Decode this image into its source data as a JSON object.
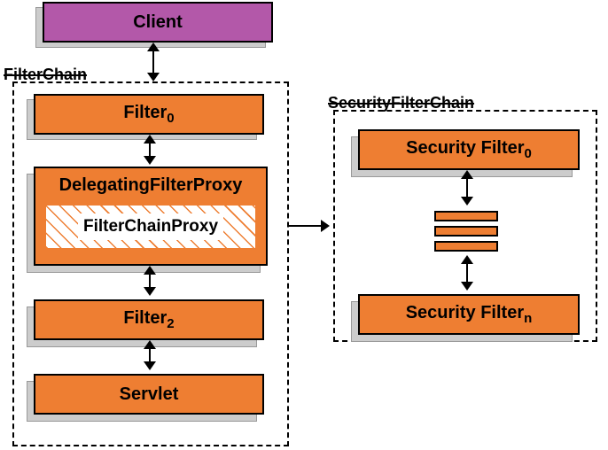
{
  "client": "Client",
  "filterchain_label": "FilterChain",
  "filter0": {
    "name": "Filter",
    "sub": "0"
  },
  "delegating": "DelegatingFilterProxy",
  "chainproxy": "FilterChainProxy",
  "filter2": {
    "name": "Filter",
    "sub": "2"
  },
  "servlet": "Servlet",
  "securitychain_label": "SecurityFilterChain",
  "secfilter0": {
    "name": "Security Filter",
    "sub": "0"
  },
  "secfiltern": {
    "name": "Security Filter",
    "sub": "n"
  }
}
